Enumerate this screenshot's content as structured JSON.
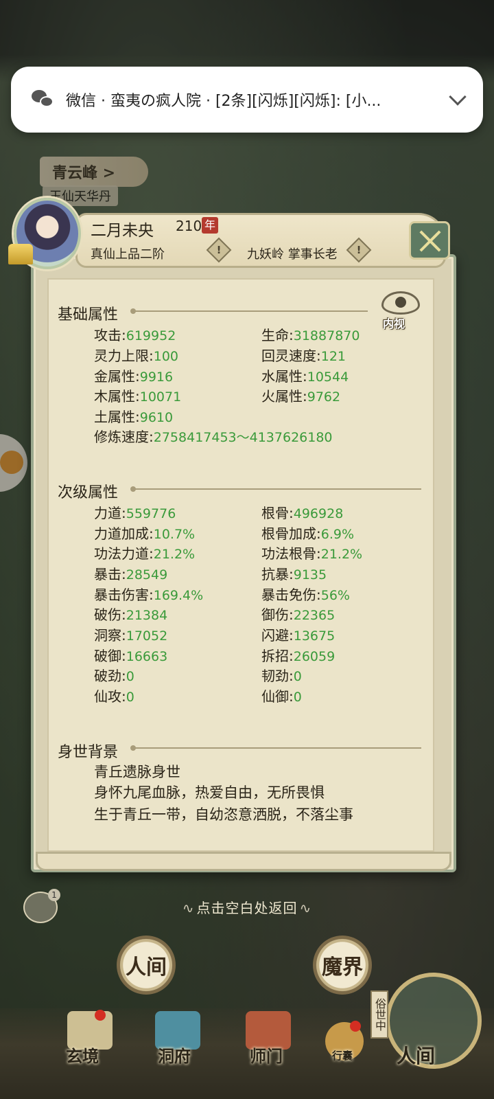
{
  "notification": {
    "text": "微信 · 蛮夷の疯人院 · [2条][闪烁][闪烁]: [小..."
  },
  "map": {
    "location": "青云峰 >",
    "item": "玉仙天华丹"
  },
  "profile": {
    "name": "二月未央",
    "age": "210",
    "age_unit": "年",
    "realm": "真仙上品二阶",
    "sect": "九妖岭 掌事长老",
    "diamond_mark": "!",
    "eye_label": "内视"
  },
  "basic": {
    "title": "基础属性",
    "stats": [
      {
        "label": "攻击",
        "value": "619952"
      },
      {
        "label": "生命",
        "value": "31887870"
      },
      {
        "label": "灵力上限",
        "value": "100"
      },
      {
        "label": "回灵速度",
        "value": "121"
      },
      {
        "label": "金属性",
        "value": "9916"
      },
      {
        "label": "水属性",
        "value": "10544"
      },
      {
        "label": "木属性",
        "value": "10071"
      },
      {
        "label": "火属性",
        "value": "9762"
      },
      {
        "label": "土属性",
        "value": "9610"
      },
      {
        "label": "修炼速度",
        "value": "2758417453～4137626180"
      }
    ]
  },
  "secondary": {
    "title": "次级属性",
    "stats": [
      {
        "label": "力道",
        "value": "559776"
      },
      {
        "label": "根骨",
        "value": "496928"
      },
      {
        "label": "力道加成",
        "value": "10.7%"
      },
      {
        "label": "根骨加成",
        "value": "6.9%"
      },
      {
        "label": "功法力道",
        "value": "21.2%"
      },
      {
        "label": "功法根骨",
        "value": "21.2%"
      },
      {
        "label": "暴击",
        "value": "28549"
      },
      {
        "label": "抗暴",
        "value": "9135"
      },
      {
        "label": "暴击伤害",
        "value": "169.4%"
      },
      {
        "label": "暴击免伤",
        "value": "56%"
      },
      {
        "label": "破伤",
        "value": "21384"
      },
      {
        "label": "御伤",
        "value": "22365"
      },
      {
        "label": "洞察",
        "value": "17052"
      },
      {
        "label": "闪避",
        "value": "13675"
      },
      {
        "label": "破御",
        "value": "16663"
      },
      {
        "label": "拆招",
        "value": "26059"
      },
      {
        "label": "破劲",
        "value": "0"
      },
      {
        "label": "韧劲",
        "value": "0"
      },
      {
        "label": "仙攻",
        "value": "0"
      },
      {
        "label": "仙御",
        "value": "0"
      }
    ]
  },
  "background": {
    "title": "身世背景",
    "lines": [
      "青丘遗脉身世",
      "身怀九尾血脉，热爱自由，无所畏惧",
      "生于青丘一带，自幼恣意洒脱，不落尘事"
    ]
  },
  "hint": "点击空白处返回",
  "chat_badge": "1",
  "realms": {
    "human": "人间",
    "demon": "魔界"
  },
  "world_tag": "俗世中",
  "nav": {
    "xuanjing": "玄境",
    "dongfu": "洞府",
    "shimen": "师门",
    "bag": "行囊",
    "renjian": "人间"
  },
  "colors": {
    "stat_value": "#3a9a3a",
    "panel_bg": "#ebe4c9",
    "close_bg": "#5e7a62",
    "year_badge": "#b43a2e"
  }
}
